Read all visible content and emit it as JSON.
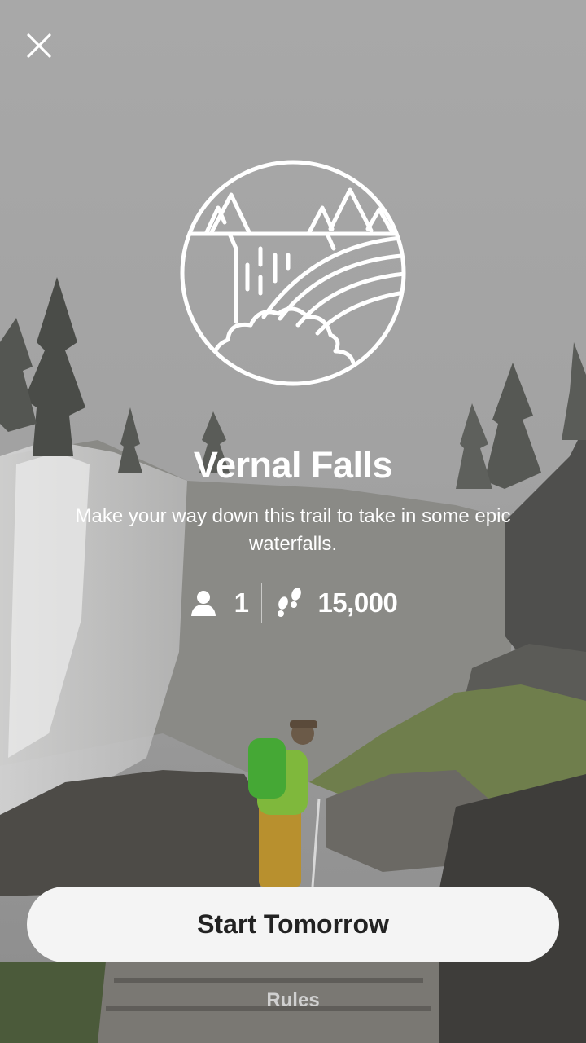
{
  "challenge": {
    "title": "Vernal Falls",
    "description": "Make your way down this trail to take in some epic waterfalls.",
    "participants": "1",
    "steps_goal": "15,000"
  },
  "actions": {
    "start_label": "Start Tomorrow",
    "rules_label": "Rules"
  },
  "icons": {
    "close": "close-icon",
    "badge": "waterfall-badge-icon",
    "participants": "person-icon",
    "steps": "footsteps-icon"
  },
  "colors": {
    "overlay_text": "#ffffff",
    "button_bg": "#f4f4f4",
    "button_text": "#222222",
    "muted_text": "#d0d0d0"
  }
}
